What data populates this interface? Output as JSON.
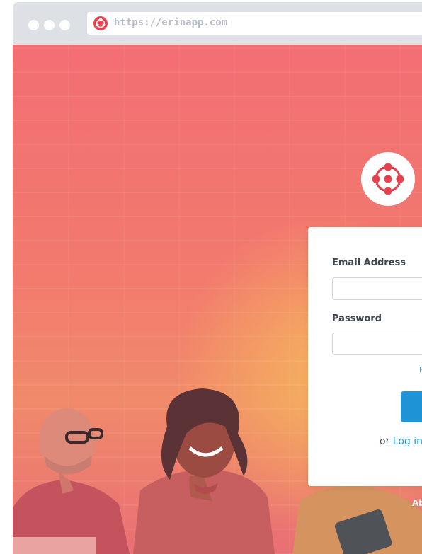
{
  "browser": {
    "url": "https://erinapp.com"
  },
  "login": {
    "email_label": "Email Address",
    "email_value": "",
    "password_label": "Password",
    "password_value": "",
    "forgot_link": "F",
    "alt_prefix": "or",
    "alt_link": "Log in"
  },
  "footer": {
    "about_link": "Ab"
  },
  "colors": {
    "primary": "#1e94d6",
    "brand_red": "#e8404c",
    "background_coral": "#f36e73",
    "background_orange": "#f6b65c"
  }
}
